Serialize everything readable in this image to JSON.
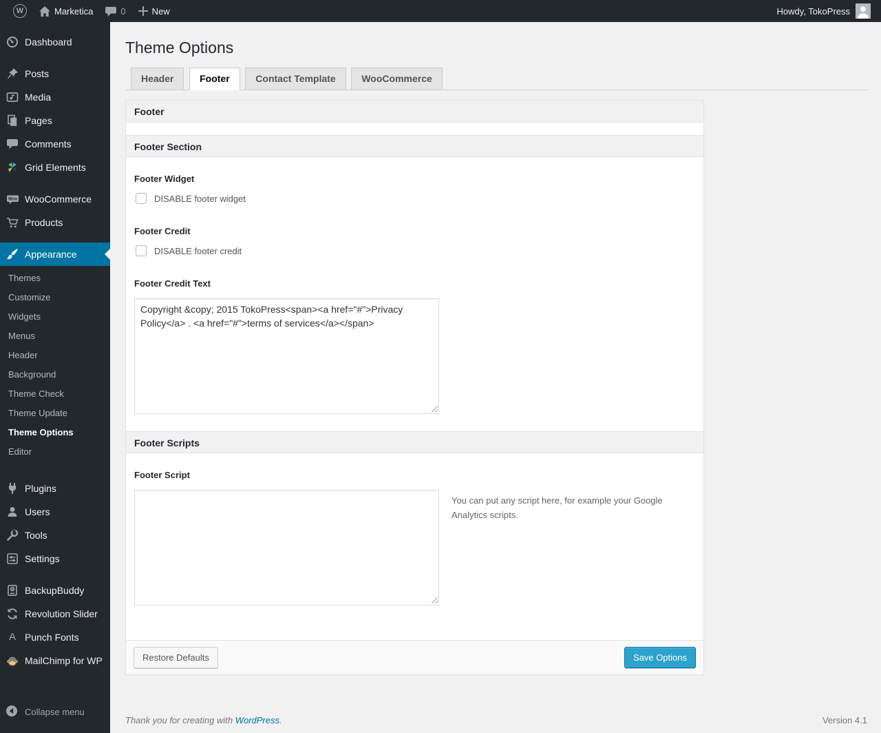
{
  "colors": {
    "admin_bg": "#23282d",
    "accent": "#0074a2",
    "primary_button": "#2ea2cc",
    "page_bg": "#f1f1f1"
  },
  "admin_bar": {
    "site_name": "Marketica",
    "comments_count": "0",
    "new_label": "New",
    "greeting": "Howdy, TokoPress"
  },
  "sidebar": {
    "items": [
      "Dashboard",
      "Posts",
      "Media",
      "Pages",
      "Comments",
      "Grid Elements",
      "WooCommerce",
      "Products",
      "Appearance",
      "Plugins",
      "Users",
      "Tools",
      "Settings",
      "BackupBuddy",
      "Revolution Slider",
      "Punch Fonts",
      "MailChimp for WP"
    ],
    "woo_badge": "Woo",
    "punch_fonts_glyph": "A",
    "submenu": [
      "Themes",
      "Customize",
      "Widgets",
      "Menus",
      "Header",
      "Background",
      "Theme Check",
      "Theme Update",
      "Theme Options",
      "Editor"
    ],
    "active_item": "Appearance",
    "active_submenu": "Theme Options",
    "collapse_label": "Collapse menu"
  },
  "page": {
    "title": "Theme Options",
    "tabs": [
      "Header",
      "Footer",
      "Contact Template",
      "WooCommerce"
    ],
    "active_tab": "Footer"
  },
  "panel": {
    "box_title": "Footer",
    "section_title": "Footer Section",
    "scripts_title": "Footer Scripts",
    "fields": {
      "footer_widget": {
        "label": "Footer Widget",
        "checkbox_label": "DISABLE footer widget",
        "checked": false
      },
      "footer_credit": {
        "label": "Footer Credit",
        "checkbox_label": "DISABLE footer credit",
        "checked": false
      },
      "footer_credit_text": {
        "label": "Footer Credit Text",
        "value": "Copyright &copy; 2015 TokoPress<span><a href=\"#\">Privacy Policy</a> . <a href=\"#\">terms of services</a></span>"
      },
      "footer_script": {
        "label": "Footer Script",
        "value": "",
        "description": "You can put any script here, for example your Google Analytics scripts."
      }
    },
    "buttons": {
      "restore": "Restore Defaults",
      "save": "Save Options"
    }
  },
  "footer": {
    "thanks_prefix": "Thank you for creating with",
    "wordpress_link": "WordPress",
    "suffix": ".",
    "version": "Version 4.1"
  }
}
